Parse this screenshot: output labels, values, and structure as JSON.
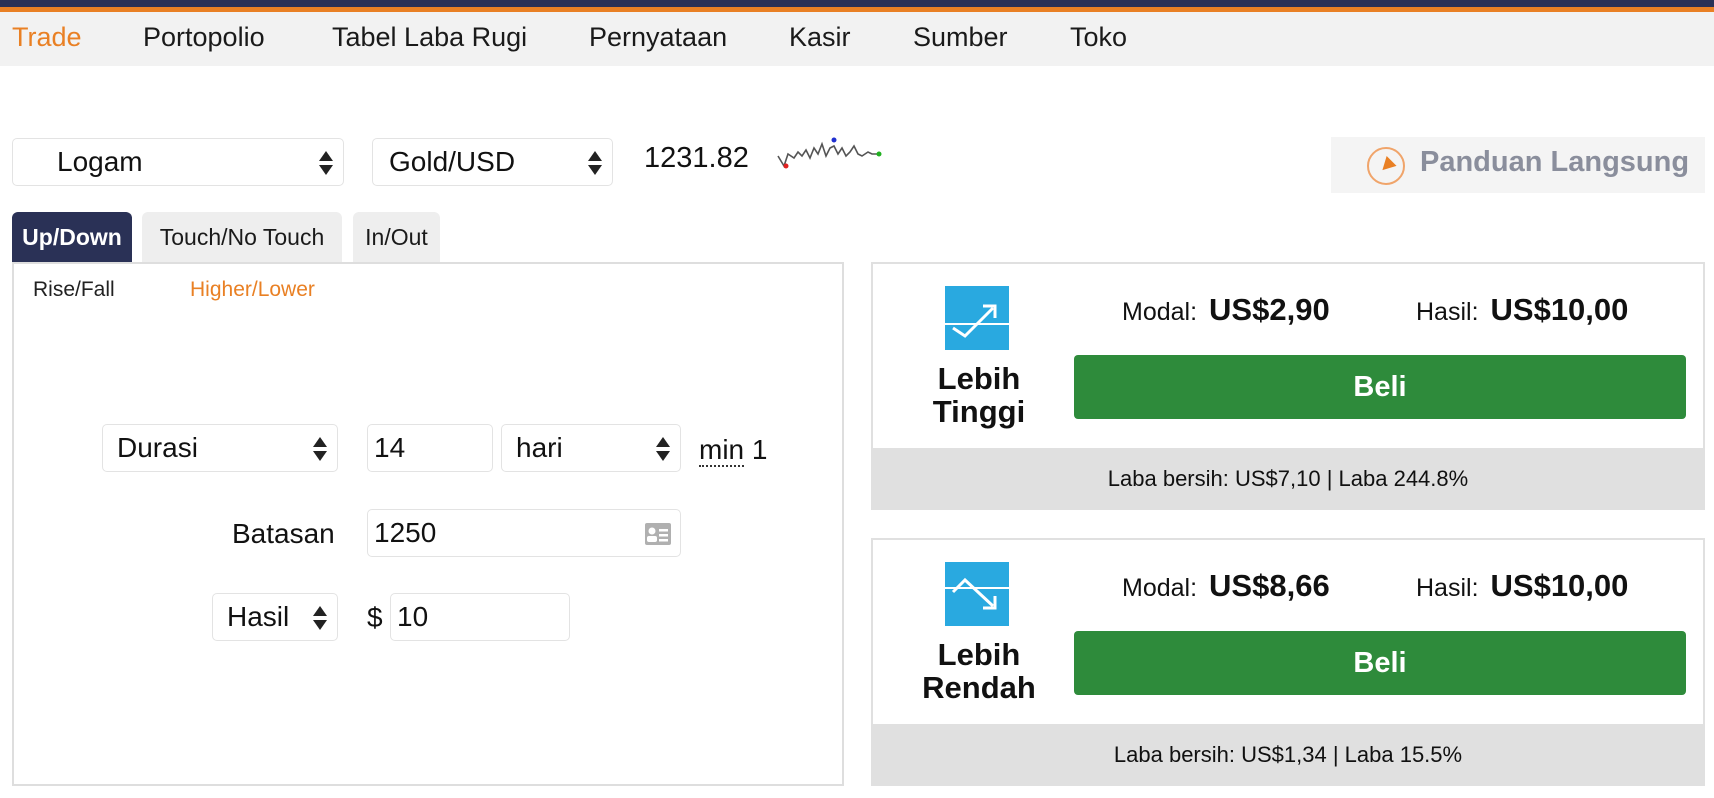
{
  "nav": {
    "items": [
      "Trade",
      "Portopolio",
      "Tabel Laba Rugi",
      "Pernyataan",
      "Kasir",
      "Sumber",
      "Toko"
    ],
    "active": "Trade"
  },
  "market": {
    "category": "Logam",
    "symbol": "Gold/USD",
    "price": "1231.82"
  },
  "guide": {
    "label": "Panduan Langsung"
  },
  "tabs": {
    "updown": "Up/Down",
    "touch": "Touch/No Touch",
    "inout": "In/Out",
    "active": "Up/Down"
  },
  "subtabs": {
    "risefall": "Rise/Fall",
    "higherlower": "Higher/Lower",
    "active": "Higher/Lower"
  },
  "form": {
    "duration_select": "Durasi",
    "duration_value": "14",
    "duration_unit": "hari",
    "min_label": "min",
    "min_value": "1",
    "barrier_label": "Batasan",
    "barrier_value": "1250",
    "payout_select": "Hasil",
    "currency_symbol": "$",
    "payout_value": "10"
  },
  "contracts": [
    {
      "title_line1": "Lebih",
      "title_line2": "Tinggi",
      "stake_label": "Modal:",
      "stake_value": "US$2,90",
      "payout_label": "Hasil:",
      "payout_value": "US$10,00",
      "buy_label": "Beli",
      "footer": "Laba bersih: US$7,10 | Laba 244.8%",
      "icon": "arrow-up-chart-icon"
    },
    {
      "title_line1": "Lebih",
      "title_line2": "Rendah",
      "stake_label": "Modal:",
      "stake_value": "US$8,66",
      "payout_label": "Hasil:",
      "payout_value": "US$10,00",
      "buy_label": "Beli",
      "footer": "Laba bersih: US$1,34 | Laba 15.5%",
      "icon": "arrow-down-chart-icon"
    }
  ],
  "colors": {
    "accent": "#e98024",
    "navy": "#2a3156",
    "buy_green": "#2e8b3b",
    "icon_blue": "#29a9e0"
  }
}
